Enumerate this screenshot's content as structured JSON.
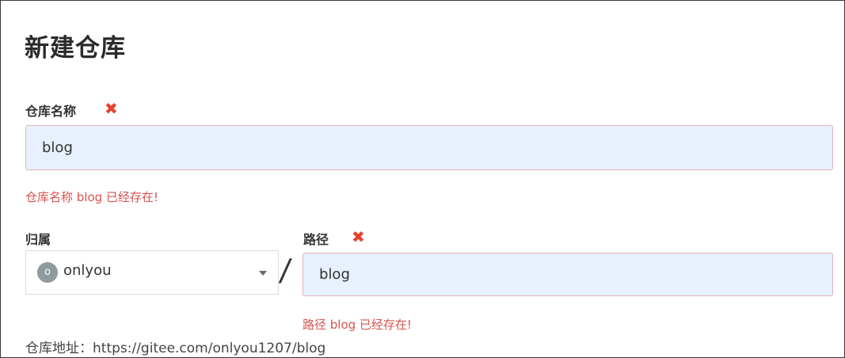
{
  "page": {
    "title": "新建仓库"
  },
  "repo_name": {
    "label": "仓库名称",
    "required_icon": "✖",
    "value": "blog",
    "error": "仓库名称 blog 已经存在!"
  },
  "owner": {
    "label": "归属",
    "avatar_initial": "o",
    "value": "onlyou",
    "separator": "/"
  },
  "path": {
    "label": "路径",
    "required_icon": "✖",
    "value": "blog",
    "error": "路径 blog 已经存在!"
  },
  "repo_url": {
    "text": "仓库地址：https://gitee.com/onlyou1207/blog"
  },
  "colors": {
    "error": "#d9534f",
    "required": "#e8412e",
    "input_bg": "#e8f0fe"
  }
}
